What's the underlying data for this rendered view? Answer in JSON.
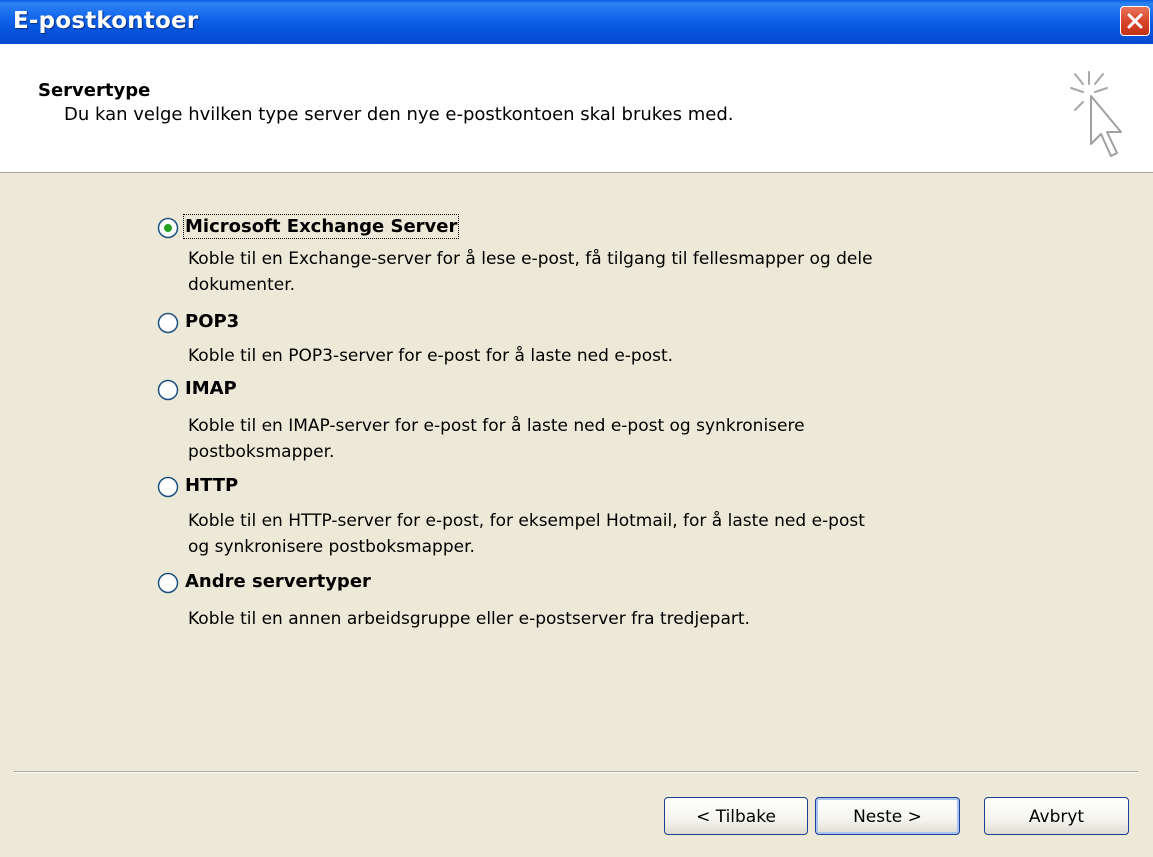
{
  "window": {
    "title": "E-postkontoer"
  },
  "header": {
    "title": "Servertype",
    "description": "Du kan velge hvilken type server den nye e-postkontoen skal brukes med."
  },
  "options": [
    {
      "label": "Microsoft Exchange Server",
      "selected": true,
      "description_lines": [
        "Koble til en Exchange-server for å lese e-post, få tilgang til fellesmapper og dele",
        "dokumenter."
      ]
    },
    {
      "label": "POP3",
      "selected": false,
      "description_lines": [
        "Koble til en POP3-server for e-post for å laste ned e-post."
      ]
    },
    {
      "label": "IMAP",
      "selected": false,
      "description_lines": [
        "Koble til en IMAP-server for e-post for å laste ned e-post og synkronisere",
        "postboksmapper."
      ]
    },
    {
      "label": "HTTP",
      "selected": false,
      "description_lines": [
        "Koble til en HTTP-server for e-post, for eksempel Hotmail, for å laste ned e-post",
        "og synkronisere postboksmapper."
      ]
    },
    {
      "label": "Andre servertyper",
      "selected": false,
      "description_lines": [
        "Koble til en annen arbeidsgruppe eller e-postserver fra tredjepart."
      ]
    }
  ],
  "buttons": {
    "back": "< Tilbake",
    "next": "Neste >",
    "cancel": "Avbryt"
  },
  "icons": {
    "close": "close-icon",
    "wizard": "cursor-sparkle-icon",
    "radio_selected": "radio-selected-icon",
    "radio_empty": "radio-empty-icon"
  },
  "colors": {
    "titlebar": "#0758e0",
    "close": "#d8452c",
    "dialog_bg": "#ece9d8",
    "header_bg": "#ffffff",
    "radio_dot": "#21a121"
  }
}
